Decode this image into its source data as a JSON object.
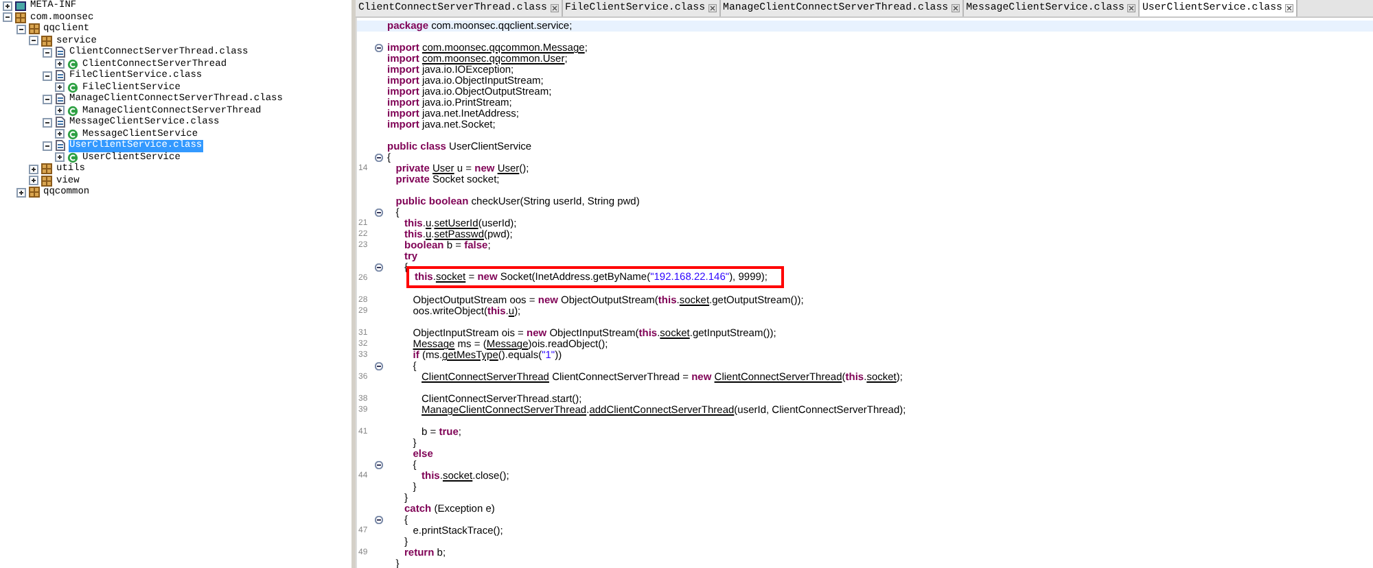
{
  "tree": [
    {
      "label": "META-INF",
      "kind": "folder",
      "expanded": false,
      "selected": false
    },
    {
      "label": "com.moonsec",
      "kind": "package",
      "expanded": true,
      "selected": false,
      "children": [
        {
          "label": "qqclient",
          "kind": "package",
          "expanded": true,
          "selected": false,
          "children": [
            {
              "label": "service",
              "kind": "package",
              "expanded": true,
              "selected": false,
              "children": [
                {
                  "label": "ClientConnectServerThread.class",
                  "kind": "classfile",
                  "expanded": true,
                  "selected": false,
                  "children": [
                    {
                      "label": "ClientConnectServerThread",
                      "kind": "class",
                      "expanded": false,
                      "selected": false
                    }
                  ]
                },
                {
                  "label": "FileClientService.class",
                  "kind": "classfile",
                  "expanded": true,
                  "selected": false,
                  "children": [
                    {
                      "label": "FileClientService",
                      "kind": "class",
                      "expanded": false,
                      "selected": false
                    }
                  ]
                },
                {
                  "label": "ManageClientConnectServerThread.class",
                  "kind": "classfile",
                  "expanded": true,
                  "selected": false,
                  "children": [
                    {
                      "label": "ManageClientConnectServerThread",
                      "kind": "class",
                      "expanded": false,
                      "selected": false
                    }
                  ]
                },
                {
                  "label": "MessageClientService.class",
                  "kind": "classfile",
                  "expanded": true,
                  "selected": false,
                  "children": [
                    {
                      "label": "MessageClientService",
                      "kind": "class",
                      "expanded": false,
                      "selected": false
                    }
                  ]
                },
                {
                  "label": "UserClientService.class",
                  "kind": "classfile",
                  "expanded": true,
                  "selected": true,
                  "children": [
                    {
                      "label": "UserClientService",
                      "kind": "class",
                      "expanded": false,
                      "selected": false
                    }
                  ]
                }
              ]
            },
            {
              "label": "utils",
              "kind": "package",
              "expanded": false,
              "selected": false
            },
            {
              "label": "view",
              "kind": "package",
              "expanded": false,
              "selected": false
            }
          ]
        },
        {
          "label": "qqcommon",
          "kind": "package",
          "expanded": false,
          "selected": false
        }
      ]
    }
  ],
  "tabs": [
    {
      "label": "ClientConnectServerThread.class",
      "selected": false
    },
    {
      "label": "FileClientService.class",
      "selected": false
    },
    {
      "label": "ManageClientConnectServerThread.class",
      "selected": false
    },
    {
      "label": "MessageClientService.class",
      "selected": false
    },
    {
      "label": "UserClientService.class",
      "selected": true
    }
  ],
  "code": [
    {
      "fold": false,
      "boxed": false,
      "seg": [
        {
          "t": "package",
          "kw": true
        },
        {
          "t": " com.moonsec.qqclient.service;"
        }
      ]
    },
    {
      "fold": false,
      "boxed": false
    },
    {
      "fold": true,
      "boxed": false,
      "seg": [
        {
          "t": "import",
          "kw": true
        },
        {
          "t": " com.moonsec.qqcommon.Message",
          "ul": true
        },
        {
          "t": ";"
        }
      ]
    },
    {
      "fold": false,
      "boxed": false,
      "seg": [
        {
          "t": "import",
          "kw": true
        },
        {
          "t": " com.moonsec.qqcommon.User",
          "ul": true
        },
        {
          "t": ";"
        }
      ]
    },
    {
      "fold": false,
      "boxed": false,
      "seg": [
        {
          "t": "import",
          "kw": true
        },
        {
          "t": " java.io.IOException;"
        }
      ]
    },
    {
      "fold": false,
      "boxed": false,
      "seg": [
        {
          "t": "import",
          "kw": true
        },
        {
          "t": " java.io.ObjectInputStream;"
        }
      ]
    },
    {
      "fold": false,
      "boxed": false,
      "seg": [
        {
          "t": "import",
          "kw": true
        },
        {
          "t": " java.io.ObjectOutputStream;"
        }
      ]
    },
    {
      "fold": false,
      "boxed": false,
      "seg": [
        {
          "t": "import",
          "kw": true
        },
        {
          "t": " java.io.PrintStream;"
        }
      ]
    },
    {
      "fold": false,
      "boxed": false,
      "seg": [
        {
          "t": "import",
          "kw": true
        },
        {
          "t": " java.net.InetAddress;"
        }
      ]
    },
    {
      "fold": false,
      "boxed": false,
      "seg": [
        {
          "t": "import",
          "kw": true
        },
        {
          "t": " java.net.Socket;"
        }
      ]
    },
    {
      "fold": false,
      "boxed": false
    },
    {
      "fold": false,
      "boxed": false,
      "seg": [
        {
          "t": "public class",
          "kw": true
        },
        {
          "t": " UserClientService"
        }
      ]
    },
    {
      "fold": true,
      "boxed": false,
      "seg": [
        {
          "t": "{"
        }
      ]
    },
    {
      "n": "14",
      "fold": false,
      "boxed": false,
      "seg": [
        {
          "t": "   private",
          "kw": true
        },
        {
          "t": " User",
          "ul": true
        },
        {
          "t": " u = "
        },
        {
          "t": "new",
          "kw": true
        },
        {
          "t": " User",
          "ul": true
        },
        {
          "t": "();"
        }
      ]
    },
    {
      "fold": false,
      "boxed": false,
      "seg": [
        {
          "t": "   private",
          "kw": true
        },
        {
          "t": " Socket socket;"
        }
      ]
    },
    {
      "fold": false,
      "boxed": false
    },
    {
      "fold": false,
      "boxed": false,
      "seg": [
        {
          "t": "   public boolean",
          "kw": true
        },
        {
          "t": " checkUser(String userId, String pwd)"
        }
      ]
    },
    {
      "fold": true,
      "boxed": false,
      "seg": [
        {
          "t": "   {"
        }
      ]
    },
    {
      "n": "21",
      "fold": false,
      "boxed": false,
      "seg": [
        {
          "t": "      this",
          "kw": true
        },
        {
          "t": "."
        },
        {
          "t": "u",
          "ul": true
        },
        {
          "t": "."
        },
        {
          "t": "setUserId",
          "ul": true
        },
        {
          "t": "(userId);"
        }
      ]
    },
    {
      "n": "22",
      "fold": false,
      "boxed": false,
      "seg": [
        {
          "t": "      this",
          "kw": true
        },
        {
          "t": "."
        },
        {
          "t": "u",
          "ul": true
        },
        {
          "t": "."
        },
        {
          "t": "setPasswd",
          "ul": true
        },
        {
          "t": "(pwd);"
        }
      ]
    },
    {
      "n": "23",
      "fold": false,
      "boxed": false,
      "seg": [
        {
          "t": "      boolean",
          "kw": true
        },
        {
          "t": " b = "
        },
        {
          "t": "false",
          "kw": true
        },
        {
          "t": ";"
        }
      ]
    },
    {
      "fold": false,
      "boxed": false,
      "seg": [
        {
          "t": "      try",
          "kw": true
        }
      ]
    },
    {
      "fold": true,
      "boxed": false,
      "seg": [
        {
          "t": "      {"
        }
      ]
    },
    {
      "n": "26",
      "fold": false,
      "boxed": true,
      "seg": [
        {
          "t": "this",
          "kw": true
        },
        {
          "t": "."
        },
        {
          "t": "socket",
          "ul": true
        },
        {
          "t": " = "
        },
        {
          "t": "new",
          "kw": true
        },
        {
          "t": " Socket(InetAddress.getByName("
        },
        {
          "t": "\"192.168.22.146\"",
          "str": true
        },
        {
          "t": "), 9999);"
        }
      ]
    },
    {
      "fold": false,
      "boxed": false
    },
    {
      "n": "28",
      "fold": false,
      "boxed": false,
      "seg": [
        {
          "t": "         ObjectOutputStream oos = "
        },
        {
          "t": "new",
          "kw": true
        },
        {
          "t": " ObjectOutputStream("
        },
        {
          "t": "this",
          "kw": true
        },
        {
          "t": "."
        },
        {
          "t": "socket",
          "ul": true
        },
        {
          "t": ".getOutputStream());"
        }
      ]
    },
    {
      "n": "29",
      "fold": false,
      "boxed": false,
      "seg": [
        {
          "t": "         oos.writeObject("
        },
        {
          "t": "this",
          "kw": true
        },
        {
          "t": "."
        },
        {
          "t": "u",
          "ul": true
        },
        {
          "t": ");"
        }
      ]
    },
    {
      "fold": false,
      "boxed": false
    },
    {
      "n": "31",
      "fold": false,
      "boxed": false,
      "seg": [
        {
          "t": "         ObjectInputStream ois = "
        },
        {
          "t": "new",
          "kw": true
        },
        {
          "t": " ObjectInputStream("
        },
        {
          "t": "this",
          "kw": true
        },
        {
          "t": "."
        },
        {
          "t": "socket",
          "ul": true
        },
        {
          "t": ".getInputStream());"
        }
      ]
    },
    {
      "n": "32",
      "fold": false,
      "boxed": false,
      "seg": [
        {
          "t": "         Message",
          "ul": true
        },
        {
          "t": " ms = ("
        },
        {
          "t": "Message",
          "ul": true
        },
        {
          "t": ")ois.readObject();"
        }
      ]
    },
    {
      "n": "33",
      "fold": false,
      "boxed": false,
      "seg": [
        {
          "t": "         if",
          "kw": true
        },
        {
          "t": " (ms."
        },
        {
          "t": "getMesType",
          "ul": true
        },
        {
          "t": "().equals("
        },
        {
          "t": "\"1\"",
          "str": true
        },
        {
          "t": "))"
        }
      ]
    },
    {
      "fold": true,
      "boxed": false,
      "seg": [
        {
          "t": "         {"
        }
      ]
    },
    {
      "n": "36",
      "fold": false,
      "boxed": false,
      "seg": [
        {
          "t": "            ClientConnectServerThread",
          "ul": true
        },
        {
          "t": " ClientConnectServerThread = "
        },
        {
          "t": "new",
          "kw": true
        },
        {
          "t": " ClientConnectServerThread",
          "ul": true
        },
        {
          "t": "("
        },
        {
          "t": "this",
          "kw": true
        },
        {
          "t": "."
        },
        {
          "t": "socket",
          "ul": true
        },
        {
          "t": ");"
        }
      ]
    },
    {
      "fold": false,
      "boxed": false
    },
    {
      "n": "38",
      "fold": false,
      "boxed": false,
      "seg": [
        {
          "t": "            ClientConnectServerThread.start();"
        }
      ]
    },
    {
      "n": "39",
      "fold": false,
      "boxed": false,
      "seg": [
        {
          "t": "            ManageClientConnectServerThread",
          "ul": true
        },
        {
          "t": "."
        },
        {
          "t": "addClientConnectServerThread",
          "ul": true
        },
        {
          "t": "(userId, ClientConnectServerThread);"
        }
      ]
    },
    {
      "fold": false,
      "boxed": false
    },
    {
      "n": "41",
      "fold": false,
      "boxed": false,
      "seg": [
        {
          "t": "            b = "
        },
        {
          "t": "true",
          "kw": true
        },
        {
          "t": ";"
        }
      ]
    },
    {
      "fold": false,
      "boxed": false,
      "seg": [
        {
          "t": "         }"
        }
      ]
    },
    {
      "fold": false,
      "boxed": false,
      "seg": [
        {
          "t": "         else",
          "kw": true
        }
      ]
    },
    {
      "fold": true,
      "boxed": false,
      "seg": [
        {
          "t": "         {"
        }
      ]
    },
    {
      "n": "44",
      "fold": false,
      "boxed": false,
      "seg": [
        {
          "t": "            this",
          "kw": true
        },
        {
          "t": "."
        },
        {
          "t": "socket",
          "ul": true
        },
        {
          "t": ".close();"
        }
      ]
    },
    {
      "fold": false,
      "boxed": false,
      "seg": [
        {
          "t": "         }"
        }
      ]
    },
    {
      "fold": false,
      "boxed": false,
      "seg": [
        {
          "t": "      }"
        }
      ]
    },
    {
      "fold": false,
      "boxed": false,
      "seg": [
        {
          "t": "      catch",
          "kw": true
        },
        {
          "t": " (Exception e)"
        }
      ]
    },
    {
      "fold": true,
      "boxed": false,
      "seg": [
        {
          "t": "      {"
        }
      ]
    },
    {
      "n": "47",
      "fold": false,
      "boxed": false,
      "seg": [
        {
          "t": "         e.printStackTrace();"
        }
      ]
    },
    {
      "fold": false,
      "boxed": false,
      "seg": [
        {
          "t": "      }"
        }
      ]
    },
    {
      "n": "49",
      "fold": false,
      "boxed": false,
      "seg": [
        {
          "t": "      return",
          "kw": true
        },
        {
          "t": " b;"
        }
      ]
    },
    {
      "fold": false,
      "boxed": false,
      "seg": [
        {
          "t": "   }"
        }
      ]
    }
  ]
}
